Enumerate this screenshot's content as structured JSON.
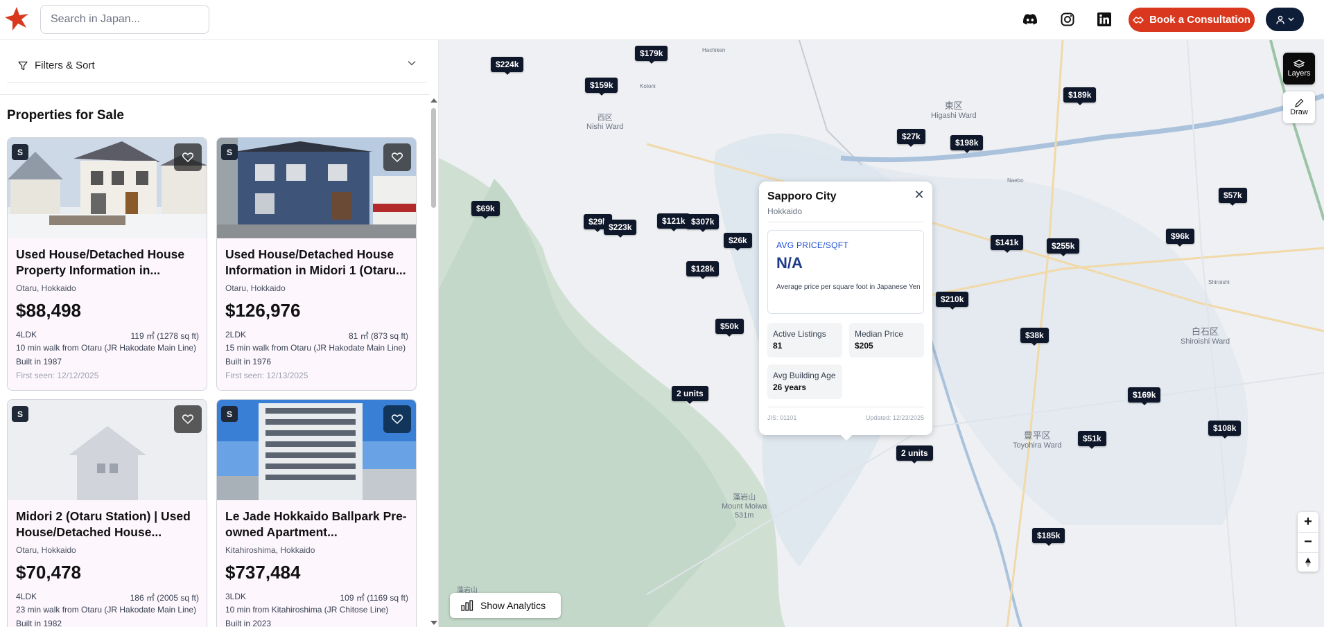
{
  "header": {
    "search_placeholder": "Search in Japan...",
    "consult_label": "Book a Consultation",
    "brand_color": "#d9381e",
    "icons": [
      "discord-icon",
      "instagram-icon",
      "linkedin-icon"
    ]
  },
  "sidebar": {
    "filters_label": "Filters & Sort",
    "section_title": "Properties for Sale",
    "listings": [
      {
        "badge": "S",
        "title": "Used House/Detached House Property Information in...",
        "location": "Otaru, Hokkaido",
        "price": "$88,498",
        "layout": "4LDK",
        "area": "119 ㎡ (1278 sq ft)",
        "access": "10 min walk from Otaru (JR Hakodate Main Line)",
        "built": "Built in 1987",
        "first_seen": "First seen: 12/12/2025"
      },
      {
        "badge": "S",
        "title": "Used House/Detached House Information in Midori 1 (Otaru...",
        "location": "Otaru, Hokkaido",
        "price": "$126,976",
        "layout": "2LDK",
        "area": "81 ㎡ (873 sq ft)",
        "access": "15 min walk from Otaru (JR Hakodate Main Line)",
        "built": "Built in 1976",
        "first_seen": "First seen: 12/13/2025"
      },
      {
        "badge": "S",
        "title": "Midori 2 (Otaru Station) | Used House/Detached House...",
        "location": "Otaru, Hokkaido",
        "price": "$70,478",
        "layout": "4LDK",
        "area": "186 ㎡ (2005 sq ft)",
        "access": "23 min walk from Otaru (JR Hakodate Main Line)",
        "built": "Built in 1982",
        "first_seen": ""
      },
      {
        "badge": "S",
        "title": "Le Jade Hokkaido Ballpark Pre-owned Apartment...",
        "location": "Kitahiroshima, Hokkaido",
        "price": "$737,484",
        "layout": "3LDK",
        "area": "109 ㎡ (1169 sq ft)",
        "access": "10 min from Kitahiroshima (JR Chitose Line)",
        "built": "Built in 2023",
        "first_seen": ""
      }
    ]
  },
  "map": {
    "pins": [
      "$224k",
      "$179k",
      "$159k",
      "$189k",
      "$27k",
      "$198k",
      "$69k",
      "$29k",
      "$223k",
      "$121k",
      "$307k",
      "$26k",
      "$57k",
      "$141k",
      "$255k",
      "$96k",
      "$128k",
      "$210k",
      "$50k",
      "$38k",
      "2 units",
      "$169k",
      "$108k",
      "$51k",
      "2 units",
      "$185k"
    ],
    "labels": [
      "西区",
      "Nishi Ward",
      "東区",
      "Higashi Ward",
      "白石区",
      "Shiroishi Ward",
      "豊平区",
      "Toyohira Ward",
      "藻岩山",
      "Mount Moiwa",
      "531m",
      "Hachiken",
      "Kotoni",
      "Naebo",
      "Shiroishi",
      "藻岩山"
    ],
    "popup": {
      "title": "Sapporo City",
      "subtitle": "Hokkaido",
      "avg_label": "AVG PRICE/SQFT",
      "avg_value": "N/A",
      "avg_desc": "Average price per square foot in Japanese Yen",
      "stats": [
        {
          "label": "Active Listings",
          "value": "81"
        },
        {
          "label": "Median Price",
          "value": "$205"
        },
        {
          "label": "Avg Building Age",
          "value": "26 years"
        }
      ],
      "jis": "JIS: 01101",
      "updated": "Updated: 12/23/2025"
    },
    "layers_label": "Layers",
    "draw_label": "Draw",
    "analytics_label": "Show Analytics"
  }
}
